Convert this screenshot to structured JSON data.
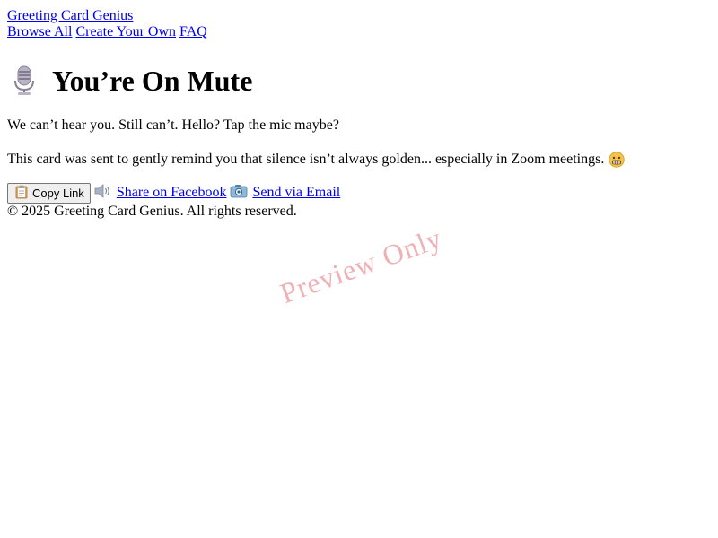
{
  "header": {
    "site_name": "Greeting Card Genius",
    "nav": [
      {
        "label": "Browse All"
      },
      {
        "label": "Create Your Own"
      },
      {
        "label": "FAQ"
      }
    ]
  },
  "card": {
    "icon": "microphone-icon",
    "title": "You’re On Mute",
    "line1": "We can’t hear you. Still can’t. Hello? Tap the mic maybe?",
    "line2": "This card was sent to gently remind you that silence isn’t always golden... especially in Zoom meetings.",
    "line2_emoji": "grimacing-face-icon"
  },
  "actions": {
    "copy_label": "Copy Link",
    "copy_icon": "clipboard-icon",
    "facebook_label": "Share on Facebook",
    "facebook_icon": "speaker-icon",
    "email_label": "Send via Email",
    "email_icon": "camera-icon"
  },
  "footer": {
    "text": "© 2025 Greeting Card Genius. All rights reserved."
  },
  "watermark": {
    "text": "Preview Only"
  },
  "colors": {
    "link": "#0000ee",
    "watermark": "#dc4650",
    "button_bg": "#efefef"
  }
}
